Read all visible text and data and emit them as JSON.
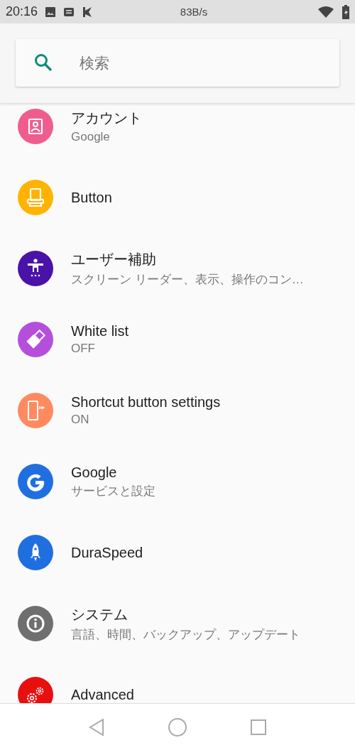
{
  "status_bar": {
    "time": "20:16",
    "speed": "83B/s"
  },
  "search": {
    "placeholder": "検索"
  },
  "items": [
    {
      "color": "#ef5d8f",
      "title": "アカウント",
      "subtitle": "Google"
    },
    {
      "color": "#ffb300",
      "title": "Button"
    },
    {
      "color": "#4b12a8",
      "title": "ユーザー補助",
      "subtitle": "スクリーン リーダー、表示、操作のコン…"
    },
    {
      "color": "#b44fdc",
      "title": "White list",
      "subtitle": "OFF"
    },
    {
      "color": "#ff8a60",
      "title": "Shortcut button settings",
      "subtitle": "ON"
    },
    {
      "color": "#1f6fe0",
      "title": "Google",
      "subtitle": "サービスと設定"
    },
    {
      "color": "#1f6fe0",
      "title": "DuraSpeed"
    },
    {
      "color": "#6f6f6f",
      "title": "システム",
      "subtitle": "言語、時間、バックアップ、アップデート"
    },
    {
      "color": "#e8100f",
      "title": "Advanced"
    }
  ]
}
